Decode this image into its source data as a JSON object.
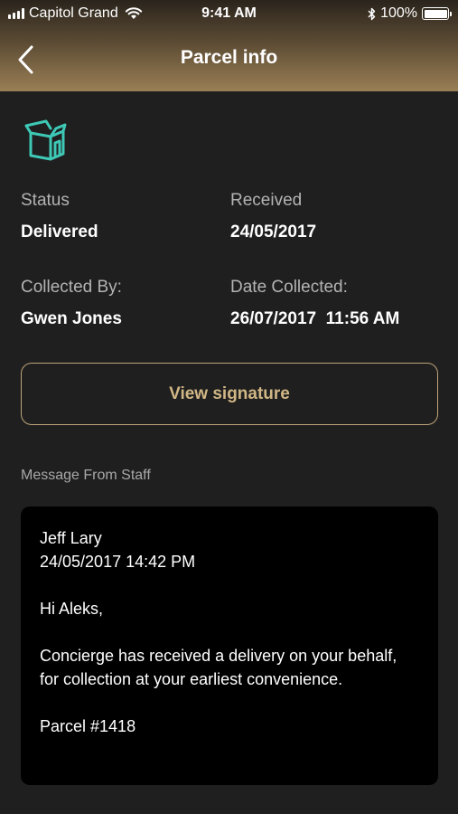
{
  "status_bar": {
    "carrier": "Capitol Grand",
    "time": "9:41 AM",
    "battery": "100%",
    "icons": [
      "signal-icon",
      "wifi-icon",
      "bluetooth-icon",
      "battery-icon"
    ]
  },
  "header": {
    "title": "Parcel info",
    "back_icon": "chevron-left-icon"
  },
  "parcel": {
    "icon": "box-icon",
    "accent_color": "#3ec9b6",
    "status_label": "Status",
    "status_value": "Delivered",
    "received_label": "Received",
    "received_value": "24/05/2017",
    "collected_by_label": "Collected By:",
    "collected_by_value": "Gwen Jones",
    "date_collected_label": "Date Collected:",
    "date_collected_value": "26/07/2017  11:56 AM"
  },
  "signature_button": {
    "label": "View signature",
    "color": "#d0b685"
  },
  "message": {
    "section_label": "Message From Staff",
    "author": "Jeff Lary",
    "timestamp": "24/05/2017 14:42 PM",
    "greeting": "Hi Aleks,",
    "body": "Concierge has received a delivery on your behalf, for collection at your earliest convenience.",
    "parcel_ref": "Parcel #1418"
  }
}
